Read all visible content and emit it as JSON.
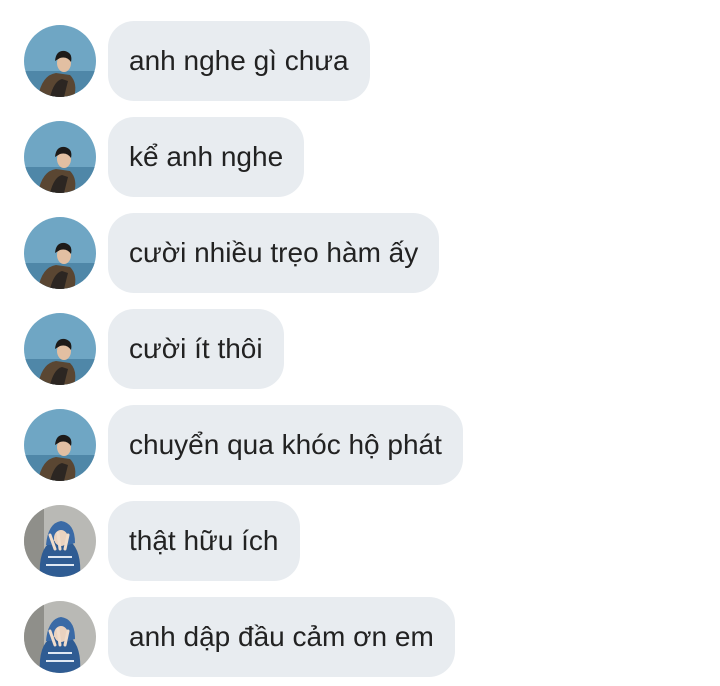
{
  "messages": [
    {
      "text": "anh nghe gì chưa",
      "sender": "boy"
    },
    {
      "text": "kể anh nghe",
      "sender": "boy"
    },
    {
      "text": "cười nhiều trẹo hàm ấy",
      "sender": "boy"
    },
    {
      "text": "cười ít thôi",
      "sender": "boy"
    },
    {
      "text": "chuyển qua khóc hộ phát",
      "sender": "boy"
    },
    {
      "text": "thật hữu ích",
      "sender": "girl"
    },
    {
      "text": "anh dập đầu cảm ơn em",
      "sender": "girl"
    }
  ],
  "colors": {
    "bubble": "#e8ecf0",
    "text": "#222222",
    "avatar_boy_bg": "#6fa6c4",
    "avatar_girl_bg": "#b9b9b5"
  },
  "icons": {
    "boy_avatar": "avatar-photo-boy-sky",
    "girl_avatar": "avatar-photo-girl-hoodie"
  }
}
